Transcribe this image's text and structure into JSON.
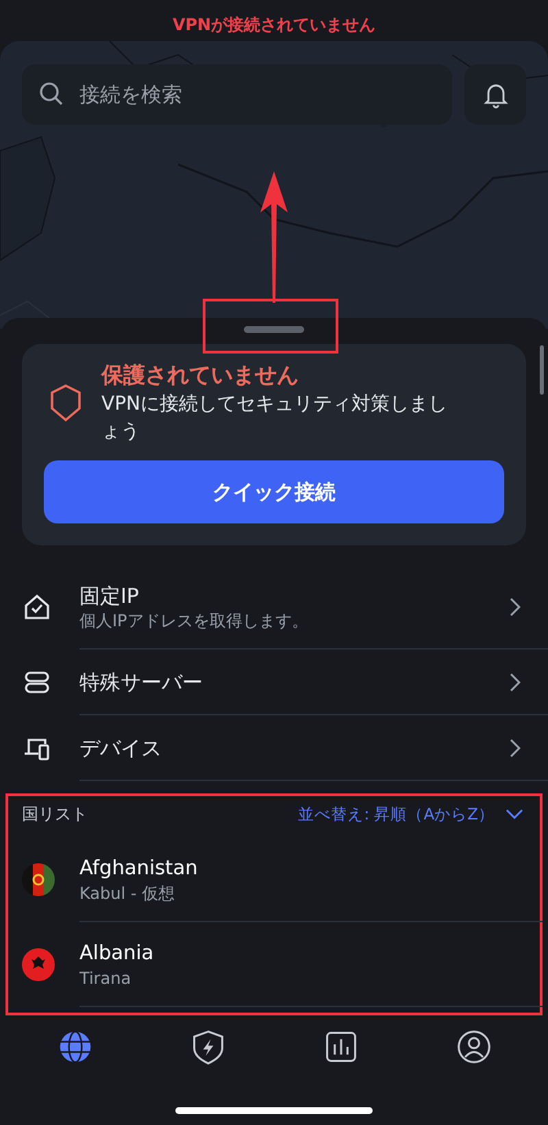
{
  "status_banner": {
    "text": "VPNが接続されていません"
  },
  "search": {
    "placeholder": "接続を検索"
  },
  "protection_card": {
    "title": "保護されていません",
    "message": "VPNに接続してセキュリティ対策しましょう",
    "button": "クイック接続"
  },
  "menu": [
    {
      "kind": "home",
      "title": "固定IP",
      "subtitle": "個人IPアドレスを取得します。"
    },
    {
      "kind": "server",
      "title": "特殊サーバー"
    },
    {
      "kind": "device",
      "title": "デバイス"
    }
  ],
  "country_list": {
    "title": "国リスト",
    "sort": "並べ替え: 昇順（AからZ）",
    "countries": [
      {
        "kind": "tricolor",
        "name": "Afghanistan",
        "city": "Kabul - 仮想"
      },
      {
        "kind": "single",
        "name": "Albania",
        "city": "Tirana"
      }
    ]
  },
  "tab_bar": [
    {
      "kind": "globe",
      "selected": true
    },
    {
      "kind": "shield",
      "selected": false
    },
    {
      "kind": "chart",
      "selected": false
    },
    {
      "kind": "profile",
      "selected": false
    }
  ]
}
